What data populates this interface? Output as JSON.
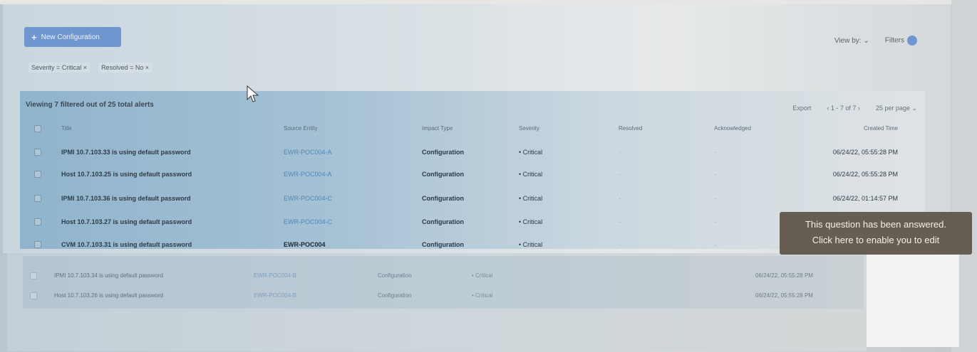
{
  "toolbar": {
    "primary_button_label": "New Configuration",
    "view_by_label": "View by:",
    "filters_label": "Filters"
  },
  "active_filters": [
    {
      "label": "Severity = Critical"
    },
    {
      "label": "Resolved = No"
    }
  ],
  "summary": {
    "viewing_text": "Viewing 7 filtered out of 25 total alerts",
    "export_label": "Export",
    "pagination_text": "1 - 7 of 7",
    "per_page_label": "25 per page"
  },
  "table": {
    "columns": [
      "Title",
      "Source Entity",
      "Impact Type",
      "Severity",
      "Resolved",
      "Acknowledged",
      "Created Time"
    ],
    "rows": [
      {
        "title": "IPMI 10.7.103.33 is using default password",
        "source": "EWR-POC004-A",
        "source_is_link": true,
        "impact": "Configuration",
        "severity": "Critical",
        "resolved": "-",
        "acknowledged": "-",
        "time": "06/24/22, 05:55:28 PM"
      },
      {
        "title": "Host 10.7.103.25 is using default password",
        "source": "EWR-POC004-A",
        "source_is_link": true,
        "impact": "Configuration",
        "severity": "Critical",
        "resolved": "-",
        "acknowledged": "-",
        "time": "06/24/22, 05:55:28 PM"
      },
      {
        "title": "IPMI 10.7.103.36 is using default password",
        "source": "EWR-POC004-C",
        "source_is_link": true,
        "impact": "Configuration",
        "severity": "Critical",
        "resolved": "-",
        "acknowledged": "-",
        "time": "06/24/22, 01:14:57 PM"
      },
      {
        "title": "Host 10.7.103.27 is using default password",
        "source": "EWR-POC004-C",
        "source_is_link": true,
        "impact": "Configuration",
        "severity": "Critical",
        "resolved": "-",
        "acknowledged": "-",
        "time": ""
      },
      {
        "title": "CVM 10.7.103.31 is using default password",
        "source": "EWR-POC004",
        "source_is_link": false,
        "impact": "Configuration",
        "severity": "Critical",
        "resolved": "-",
        "acknowledged": "-",
        "time": ""
      }
    ],
    "lower_rows": [
      {
        "title": "IPMI 10.7.103.34 is using default password",
        "source": "EWR-POC004-B",
        "impact": "Configuration",
        "severity": "Critical",
        "time": "06/24/22, 05:55:28 PM"
      },
      {
        "title": "Host 10.7.103.26 is using default password",
        "source": "EWR-POC004-B",
        "impact": "Configuration",
        "severity": "Critical",
        "time": "06/24/22, 05:55:28 PM"
      }
    ]
  },
  "tooltip": {
    "line1": "This question has been answered.",
    "line2": "Click here to enable you to edit"
  },
  "colors": {
    "primary": "#6f96cf",
    "link": "#4f86bd",
    "tooltip_bg": "#5c5246"
  }
}
